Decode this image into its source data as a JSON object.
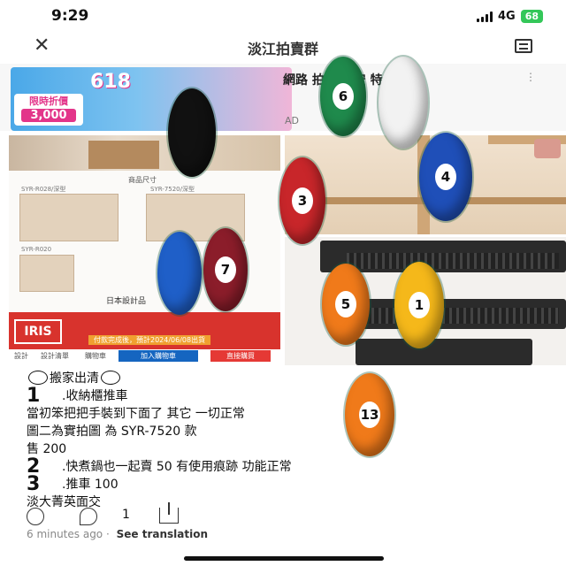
{
  "status_bar": {
    "time": "9:29",
    "network": "4G",
    "battery": "68"
  },
  "nav": {
    "title": "淡江拍賣群"
  },
  "ad": {
    "title": "網路 拍 元捷安 特・ B",
    "label": "AD",
    "banner": {
      "headline": "618",
      "left_panel_title": "限時折價",
      "left_panel_price": "3,000"
    }
  },
  "product_card": {
    "size_title": "商品尺寸",
    "shelf_labels": [
      "SYR-R028/深型",
      "SYR-7520/深型",
      "SYR-R020"
    ],
    "brand": "IRIS",
    "design_title": "日本設計品",
    "promo": "付款完成後，預計2024/06/08出貨",
    "footer": {
      "shop": "設計",
      "store": "設計清單",
      "cart_count": "購物車",
      "add_cart": "加入購物車",
      "buy_now": "直接購買"
    }
  },
  "post": {
    "heading": "搬家出清",
    "items": [
      {
        "num": "1",
        "text": ".收納櫃推車"
      },
      {
        "num": "",
        "text": "當初笨把把手裝到下面了 其它 一切正常"
      },
      {
        "num": "",
        "text": "圖二為實拍圖 為 SYR-7520 款"
      },
      {
        "num": "",
        "text": "售 200"
      },
      {
        "num": "2",
        "text": ".快煮鍋也一起賣 50 有使用痕跡 功能正常"
      },
      {
        "num": "3",
        "text": ".推車 100"
      },
      {
        "num": "",
        "text": "淡大菁英面交"
      }
    ]
  },
  "actions": {
    "comment_count": "1"
  },
  "meta": {
    "time": "6 minutes ago",
    "separator": "·",
    "translate": "See translation"
  },
  "billiard_balls": [
    {
      "number": "6",
      "color": "#1f8a4c"
    },
    {
      "number": "",
      "color": "#f2f2f2"
    },
    {
      "number": "",
      "color": "#111111"
    },
    {
      "number": "4",
      "color": "#1f4fb8"
    },
    {
      "number": "3",
      "color": "#c8262a"
    },
    {
      "number": "",
      "color": "#1f5fc8"
    },
    {
      "number": "7",
      "color": "#8b1d2a"
    },
    {
      "number": "5",
      "color": "#f07a1a"
    },
    {
      "number": "1",
      "color": "#f5b81a"
    },
    {
      "number": "13",
      "color": "#f07a1a"
    }
  ]
}
